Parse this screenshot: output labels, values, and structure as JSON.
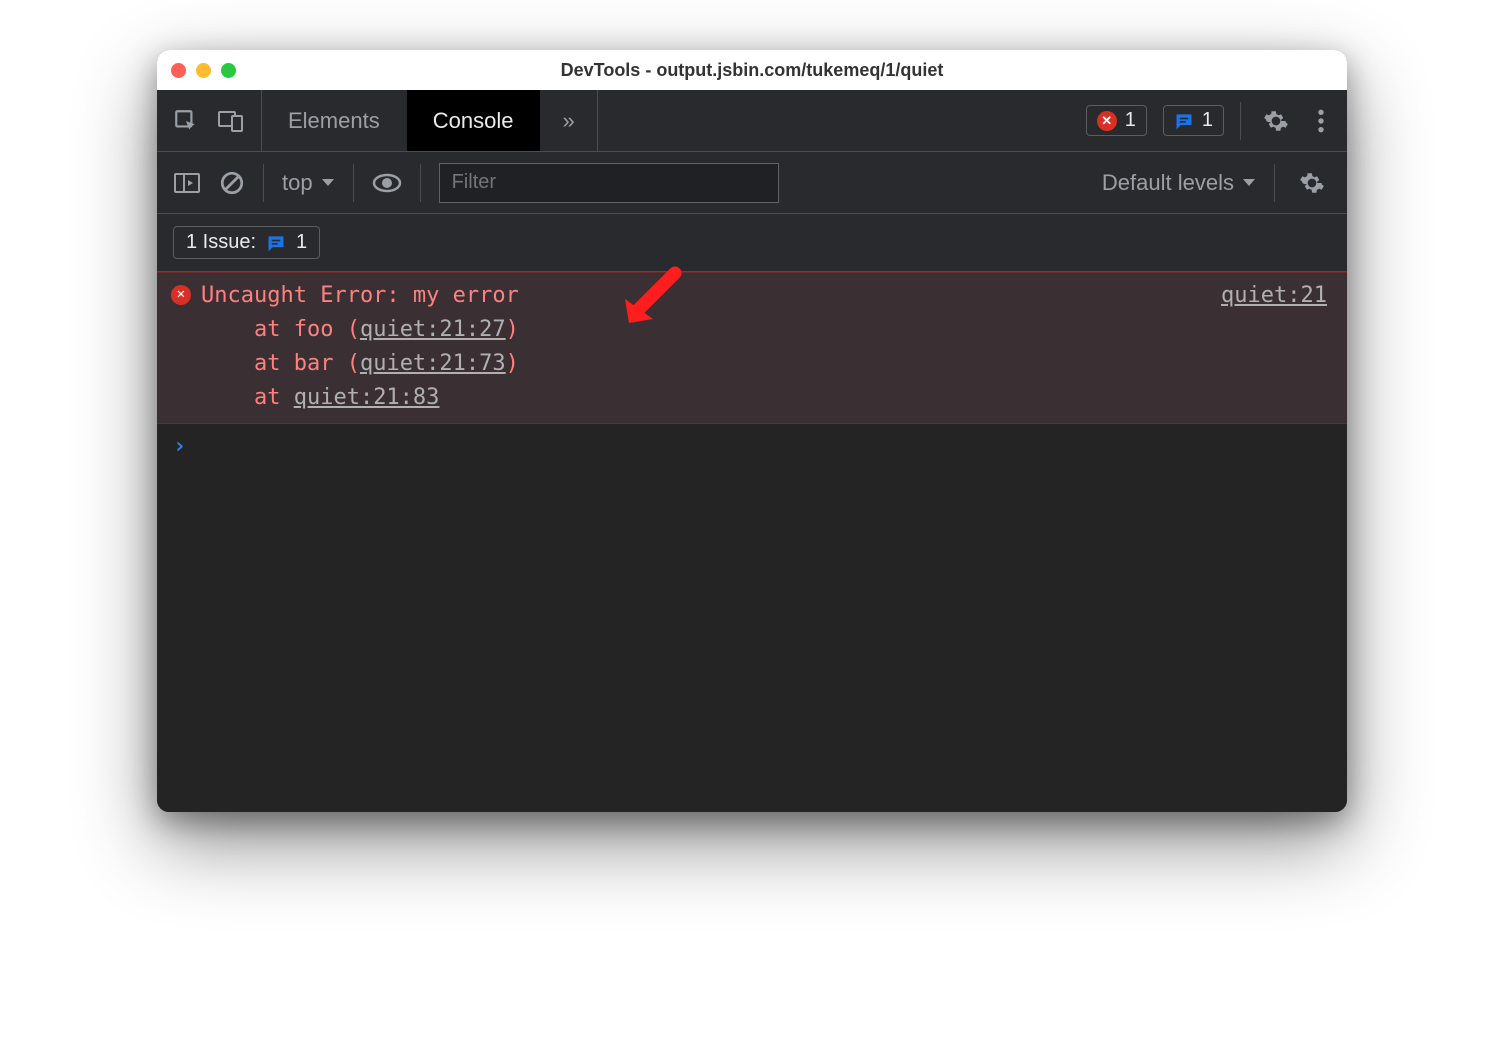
{
  "window": {
    "title": "DevTools - output.jsbin.com/tukemeq/1/quiet"
  },
  "tabs": {
    "elements": "Elements",
    "console": "Console",
    "more_glyph": "»"
  },
  "counters": {
    "errors": "1",
    "issues": "1"
  },
  "console_toolbar": {
    "context": "top",
    "filter_placeholder": "Filter",
    "levels": "Default levels"
  },
  "issues_bar": {
    "label": "1 Issue:",
    "count": "1"
  },
  "error": {
    "message": "Uncaught Error: my error",
    "stack": [
      {
        "prefix": "    at foo (",
        "link": "quiet:21:27",
        "suffix": ")"
      },
      {
        "prefix": "    at bar (",
        "link": "quiet:21:73",
        "suffix": ")"
      },
      {
        "prefix": "    at ",
        "link": "quiet:21:83",
        "suffix": ""
      }
    ],
    "source_link": "quiet:21"
  },
  "prompt_glyph": "›"
}
